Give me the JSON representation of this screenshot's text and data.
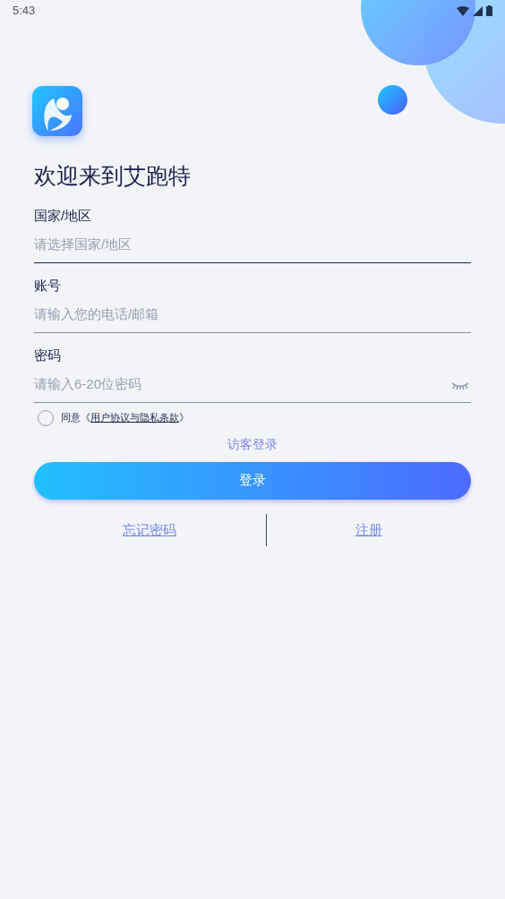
{
  "status_bar": {
    "time": "5:43"
  },
  "title": "欢迎来到艾跑特",
  "fields": [
    {
      "label": "国家/地区",
      "placeholder": "请选择国家/地区",
      "focused": true,
      "kind": "select"
    },
    {
      "label": "账号",
      "placeholder": "请输入您的电话/邮箱",
      "focused": false,
      "kind": "text"
    },
    {
      "label": "密码",
      "placeholder": "请输入6-20位密码",
      "focused": false,
      "kind": "password"
    }
  ],
  "agreement": {
    "checked": false,
    "prefix": "同意《",
    "link": "用户协议与隐私条款",
    "suffix": "》"
  },
  "guest_login": "访客登录",
  "login_button": "登录",
  "links": [
    "忘记密码",
    "注册"
  ]
}
